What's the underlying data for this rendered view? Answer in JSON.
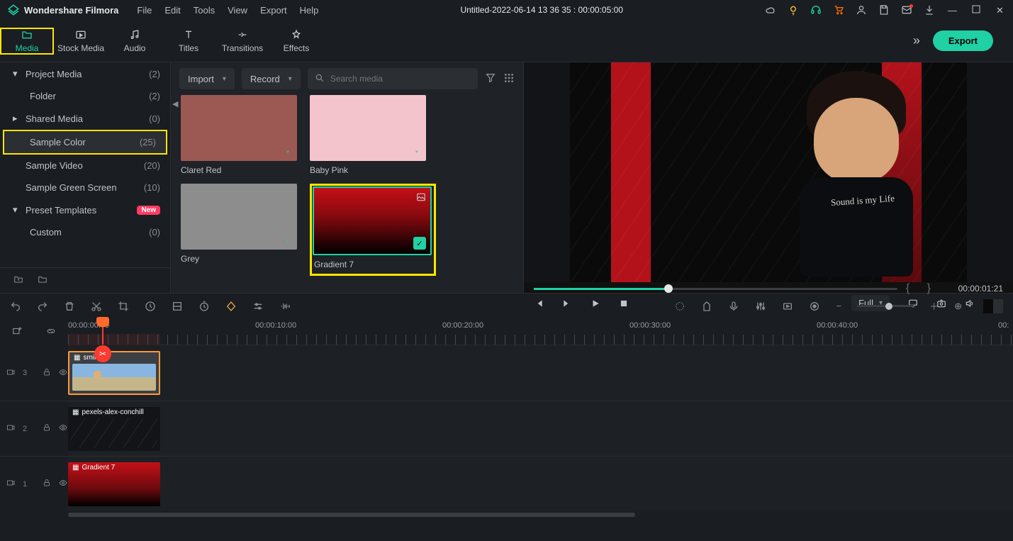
{
  "app": {
    "title": "Wondershare Filmora"
  },
  "menu": [
    "File",
    "Edit",
    "Tools",
    "View",
    "Export",
    "Help"
  ],
  "project_title": "Untitled-2022-06-14 13 36 35 : 00:00:05:00",
  "tool_tabs": [
    {
      "label": "Media",
      "active": true
    },
    {
      "label": "Stock Media"
    },
    {
      "label": "Audio"
    },
    {
      "label": "Titles"
    },
    {
      "label": "Transitions"
    },
    {
      "label": "Effects"
    }
  ],
  "export_label": "Export",
  "sidebar": [
    {
      "label": "Project Media",
      "count": "(2)",
      "level": 0,
      "expand": "down"
    },
    {
      "label": "Folder",
      "count": "(2)",
      "level": 1
    },
    {
      "label": "Shared Media",
      "count": "(0)",
      "level": 0,
      "expand": "right"
    },
    {
      "label": "Sample Color",
      "count": "(25)",
      "level": 0,
      "highlight": true
    },
    {
      "label": "Sample Video",
      "count": "(20)",
      "level": 0
    },
    {
      "label": "Sample Green Screen",
      "count": "(10)",
      "level": 0
    },
    {
      "label": "Preset Templates",
      "count": "",
      "level": 0,
      "expand": "down",
      "new_badge": "New"
    },
    {
      "label": "Custom",
      "count": "(0)",
      "level": 1
    }
  ],
  "media_top": {
    "import_label": "Import",
    "record_label": "Record",
    "search_placeholder": "Search media"
  },
  "thumbs": {
    "claret": "Claret Red",
    "pink": "Baby Pink",
    "grey": "Grey",
    "gradient7": "Gradient 7"
  },
  "preview": {
    "timecode": "00:00:01:21",
    "quality_label": "Full",
    "kid_text": "Sound is my Life"
  },
  "timeline": {
    "ruler_labels": [
      "00:00:00:00",
      "00:00:10:00",
      "00:00:20:00",
      "00:00:30:00",
      "00:00:40:00",
      "00:"
    ],
    "tracks": [
      {
        "key": "t3",
        "label": "3"
      },
      {
        "key": "t2",
        "label": "2"
      },
      {
        "key": "t1",
        "label": "1"
      }
    ],
    "clip1_title": "smile2",
    "clip2_title": "pexels-alex-conchill",
    "clip3_title": "Gradient 7"
  }
}
